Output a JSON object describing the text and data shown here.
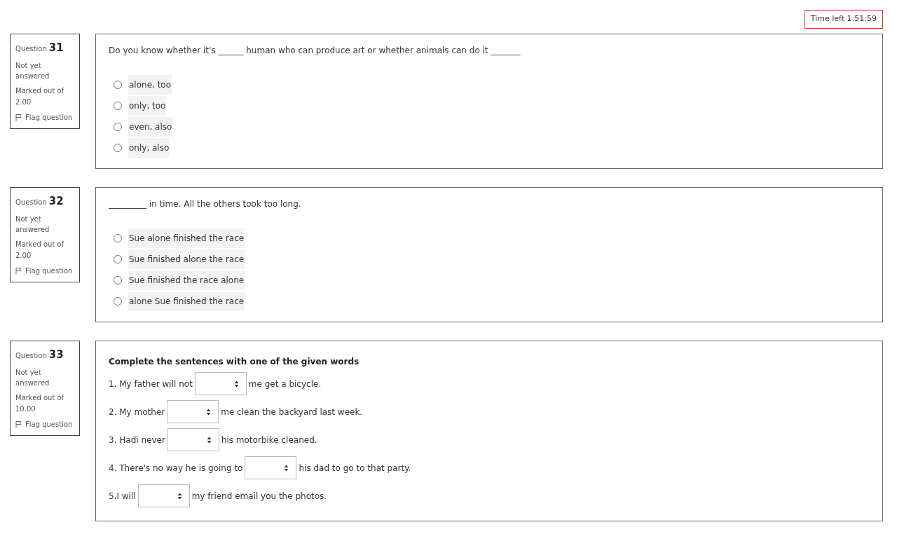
{
  "timer": {
    "label": "Time left 1:51:59"
  },
  "questions": [
    {
      "kind": "choice",
      "label": "Question",
      "number": "31",
      "status": "Not yet answered",
      "marked_label": "Marked out of",
      "marked_value": "2.00",
      "flag": {
        "label": "Flag question",
        "flagged": false
      },
      "prompt": "Do you know whether it's ______ human who can produce art or whether animals can do it _______",
      "options": [
        {
          "text": "alone, too",
          "selected": false
        },
        {
          "text": "only, too",
          "selected": false
        },
        {
          "text": "even, also",
          "selected": false
        },
        {
          "text": "only, also",
          "selected": false
        }
      ]
    },
    {
      "kind": "choice",
      "label": "Question",
      "number": "32",
      "status": "Not yet answered",
      "marked_label": "Marked out of",
      "marked_value": "2.00",
      "flag": {
        "label": "Flag question",
        "flagged": false
      },
      "prompt": "_________ in time. All the others took too long.",
      "options": [
        {
          "text": "Sue alone finished the race",
          "selected": false
        },
        {
          "text": "Sue finished alone the race",
          "selected": false
        },
        {
          "text": "Sue finished the race alone",
          "selected": false
        },
        {
          "text": "alone Sue finished the race",
          "selected": false
        }
      ]
    },
    {
      "kind": "gapselect",
      "label": "Question",
      "number": "33",
      "status": "Not yet answered",
      "marked_label": "Marked out of",
      "marked_value": "10.00",
      "flag": {
        "label": "Flag question",
        "flagged": false
      },
      "prompt": "Complete the sentences with one of the given words",
      "sentences": [
        {
          "before": "1. My father will not",
          "after": "me get a bicycle."
        },
        {
          "before": "2. My mother",
          "after": "me clean the backyard last week."
        },
        {
          "before": "3. Hadi never",
          "after": "his motorbike cleaned."
        },
        {
          "before": "4. There's no way he is going to",
          "after": "his dad to go to that party."
        },
        {
          "before": "5.I will",
          "after": "my friend email you the photos."
        }
      ]
    }
  ]
}
